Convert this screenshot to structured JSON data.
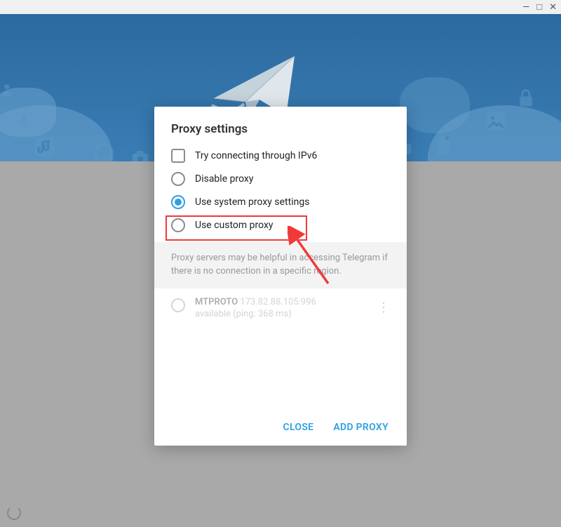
{
  "window": {
    "minimize": "—",
    "maximize": "□",
    "close": "✕"
  },
  "dialog": {
    "title": "Proxy settings",
    "options": {
      "ipv6": "Try connecting through IPv6",
      "disable": "Disable proxy",
      "system": "Use system proxy settings",
      "custom": "Use custom proxy",
      "selected": "system"
    },
    "info": "Proxy servers may be helpful in accessing Telegram if there is no connection in a specific region.",
    "proxies": [
      {
        "protocol": "MTPROTO",
        "address": "173.82.88.105:996",
        "status": "available (ping: 368 ms)"
      }
    ],
    "actions": {
      "close": "CLOSE",
      "add": "ADD PROXY"
    }
  },
  "colors": {
    "accent": "#2fa0e2",
    "annotation": "#f03a3a"
  }
}
